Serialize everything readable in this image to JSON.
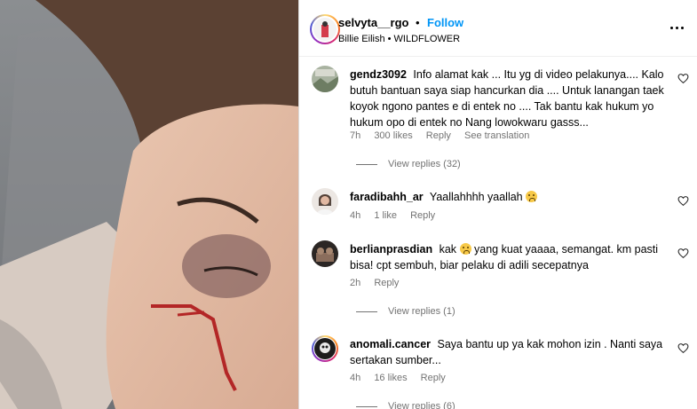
{
  "media": {
    "description_icon": "post-photo"
  },
  "header": {
    "username": "selvyta__rgo",
    "separator": "•",
    "follow_label": "Follow",
    "song": "Billie Eilish • WILDFLOWER",
    "more_icon": "more-horizontal-icon"
  },
  "comments": [
    {
      "username": "gendz3092",
      "text": "Info alamat kak ... Itu yg di video pelakunya.... Kalo butuh bantuan saya siap hancurkan dia .... Untuk lanangan taek koyok ngono pantes e di entek no .... Tak bantu kak hukum yo hukum opo di entek no Nang lowokwaru gasss...",
      "time": "7h",
      "likes": "300 likes",
      "reply": "Reply",
      "translate": "See translation",
      "view_replies": "View replies (32)"
    },
    {
      "username": "faradibahh_ar",
      "text": "Yaallahhhh yaallah",
      "time": "4h",
      "likes": "1 like",
      "reply": "Reply"
    },
    {
      "username": "berlianprasdian",
      "text_before": "kak",
      "text_after": "yang kuat yaaaa, semangat. km pasti bisa! cpt sembuh, biar pelaku di adili secepatnya",
      "time": "2h",
      "reply": "Reply",
      "view_replies": "View replies (1)"
    },
    {
      "username": "anomali.cancer",
      "text": "Saya bantu up ya kak mohon izin . Nanti saya sertakan sumber...",
      "time": "4h",
      "likes": "16 likes",
      "reply": "Reply",
      "view_replies": "View replies (6)"
    }
  ],
  "colors": {
    "link": "#0095f6",
    "meta": "#737373"
  }
}
